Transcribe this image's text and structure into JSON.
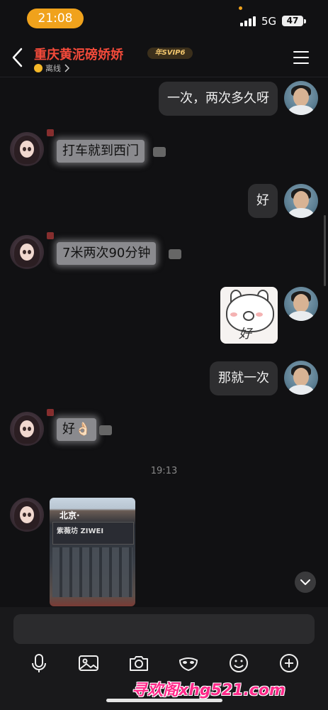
{
  "status_bar": {
    "time": "21:08",
    "network": "5G",
    "battery": "47"
  },
  "header": {
    "title": "重庆黄泥磅娇娇",
    "vip_badge": "年SVIP6",
    "subtitle": "离线"
  },
  "messages": [
    {
      "from": "me",
      "text": "一次，两次多久呀"
    },
    {
      "from": "her",
      "text": "打车就到西门"
    },
    {
      "from": "me",
      "text": "好"
    },
    {
      "from": "her",
      "text": "7米两次90分钟"
    },
    {
      "from": "me",
      "type": "sticker",
      "text": "好"
    },
    {
      "from": "me",
      "text": "那就一次"
    },
    {
      "from": "her",
      "text": "好👌🏻"
    },
    {
      "type": "timestamp",
      "text": "19:13"
    },
    {
      "from": "her",
      "type": "photo",
      "sign_text": "紫薇坊 ZIWEI",
      "top_text": "北京·"
    }
  ],
  "toolbar": {
    "icons": [
      "microphone-icon",
      "image-icon",
      "camera-icon",
      "mask-icon",
      "emoji-icon",
      "plus-icon"
    ]
  },
  "watermark": "寻欢阁xhg521.com",
  "colors": {
    "accent": "#f0a21c",
    "title": "#f24a3a",
    "watermark": "#ff2a8a"
  }
}
